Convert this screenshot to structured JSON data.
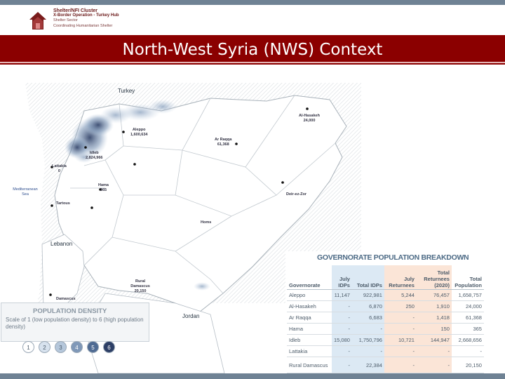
{
  "header": {
    "logo": {
      "line1": "Shelter/NFI Cluster",
      "line2": "X-Border Operation - Turkey Hub",
      "line3": "Shelter Sector",
      "line4": "Coordinating Humanitarian Shelter"
    },
    "title": "North-West Syria (NWS) Context"
  },
  "map": {
    "countries": {
      "turkey": "Turkey",
      "lebanon": "Lebanon",
      "jordan": "Jordan"
    },
    "sea": "Mediterranean Sea",
    "cities": {
      "aleppo": "Aleppo",
      "aleppo_pop": "1,600,634",
      "idleb": "Idleb",
      "idleb_pop": "2,824,966",
      "lattakia": "Lattakia",
      "lattakia_pop": "0",
      "tartous": "Tartous",
      "hama": "Hama",
      "hama_pop": "365",
      "homs": "Homs",
      "ar_raqqa": "Ar Raqqa",
      "ar_raqqa_pop": "61,368",
      "al_hasakeh": "Al-Hasakeh",
      "al_hasakeh_pop": "24,000",
      "deir_ez_zor": "Deir-ez-Zor",
      "damascus": "Damascus",
      "rural_damascus": "Rural Damascus",
      "rural_damascus_pop": "20,150"
    }
  },
  "legend": {
    "title": "POPULATION DENSITY",
    "description": "Scale of 1 (low population density) to 6 (high population density)",
    "scale": [
      {
        "label": "1",
        "fill": "#ffffff",
        "text": "#4a5a6a"
      },
      {
        "label": "2",
        "fill": "#d7e2ee",
        "text": "#4a5a6a"
      },
      {
        "label": "3",
        "fill": "#b5c7db",
        "text": "#4a5a6a"
      },
      {
        "label": "4",
        "fill": "#7f98b8",
        "text": "#ffffff"
      },
      {
        "label": "5",
        "fill": "#4f6b93",
        "text": "#ffffff"
      },
      {
        "label": "6",
        "fill": "#2d3f66",
        "text": "#ffffff"
      }
    ]
  },
  "table": {
    "title": "GOVERNORATE POPULATION BREAKDOWN",
    "headers": {
      "governorate": "Governorate",
      "july_idps": "July IDPs",
      "total_idps": "Total IDPs",
      "july_returnees": "July Returnees",
      "total_returnees": "Total Returnees (2020)",
      "total_population": "Total Population"
    },
    "rows": [
      {
        "gov": "Aleppo",
        "july_idps": "11,147",
        "total_idps": "922,981",
        "july_ret": "5,244",
        "total_ret": "76,457",
        "total_pop": "1,658,757"
      },
      {
        "gov": "Al-Hasakeh",
        "july_idps": "-",
        "total_idps": "6,870",
        "july_ret": "250",
        "total_ret": "1,910",
        "total_pop": "24,000"
      },
      {
        "gov": "Ar Raqqa",
        "july_idps": "-",
        "total_idps": "6,683",
        "july_ret": "-",
        "total_ret": "1,418",
        "total_pop": "61,368"
      },
      {
        "gov": "Hama",
        "july_idps": "-",
        "total_idps": "-",
        "july_ret": "-",
        "total_ret": "150",
        "total_pop": "365"
      },
      {
        "gov": "Idleb",
        "july_idps": "15,080",
        "total_idps": "1,750,796",
        "july_ret": "10,721",
        "total_ret": "144,947",
        "total_pop": "2,668,656"
      },
      {
        "gov": "Lattakia",
        "july_idps": "-",
        "total_idps": "-",
        "july_ret": "-",
        "total_ret": "-",
        "total_pop": "-"
      },
      {
        "gov": "Rural Damascus",
        "july_idps": "-",
        "total_idps": "22,384",
        "july_ret": "-",
        "total_ret": "-",
        "total_pop": "20,150"
      }
    ]
  },
  "colors": {
    "title_bar": "#8b0000",
    "frame_bar": "#6f8294",
    "logo": "#6b1a1a",
    "idp_column": "#dce9f4",
    "returnee_column": "#fbe5d7"
  }
}
